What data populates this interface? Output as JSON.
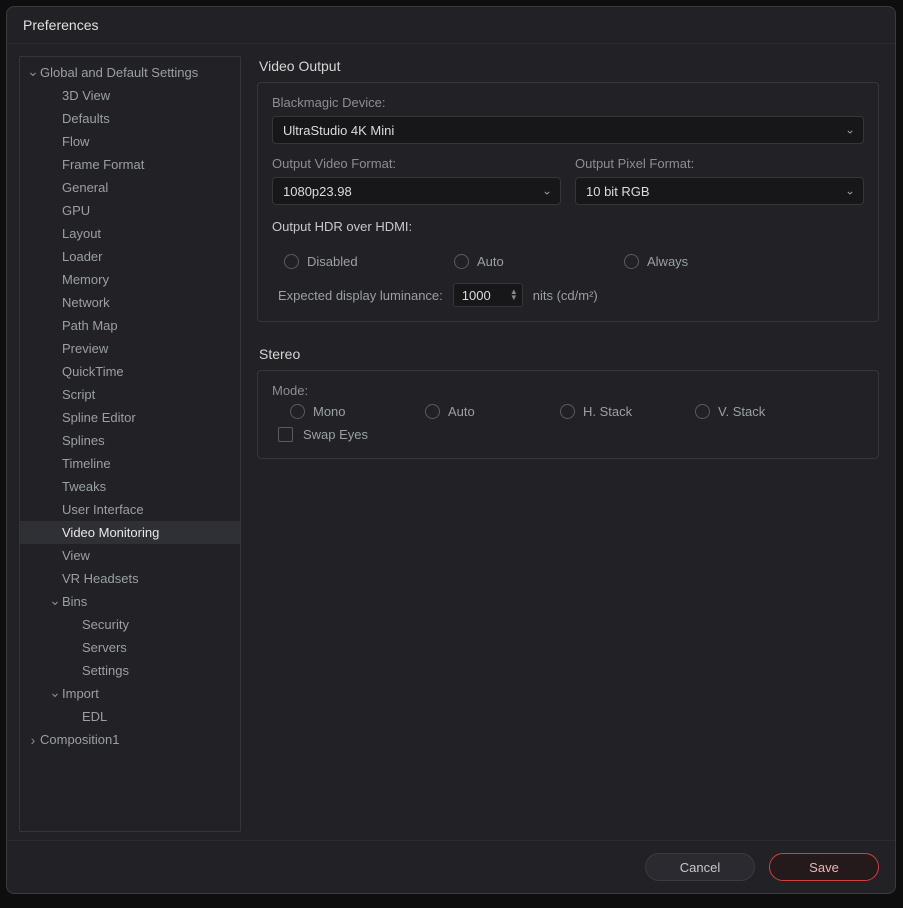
{
  "window": {
    "title": "Preferences"
  },
  "sidebar": {
    "group_global": "Global and Default Settings",
    "items_global": [
      "3D View",
      "Defaults",
      "Flow",
      "Frame Format",
      "General",
      "GPU",
      "Layout",
      "Loader",
      "Memory",
      "Network",
      "Path Map",
      "Preview",
      "QuickTime",
      "Script",
      "Spline Editor",
      "Splines",
      "Timeline",
      "Tweaks",
      "User Interface",
      "Video Monitoring",
      "View",
      "VR Headsets"
    ],
    "group_bins": "Bins",
    "items_bins": [
      "Security",
      "Servers",
      "Settings"
    ],
    "group_import": "Import",
    "items_import": [
      "EDL"
    ],
    "composition": "Composition1",
    "selected": "Video Monitoring"
  },
  "video_output": {
    "section": "Video Output",
    "device_label": "Blackmagic Device:",
    "device_value": "UltraStudio 4K Mini",
    "video_format_label": "Output Video Format:",
    "video_format_value": "1080p23.98",
    "pixel_format_label": "Output Pixel Format:",
    "pixel_format_value": "10 bit RGB",
    "hdr_label": "Output HDR over HDMI:",
    "hdr_options": {
      "disabled": "Disabled",
      "auto": "Auto",
      "always": "Always"
    },
    "luminance_label": "Expected display luminance:",
    "luminance_value": "1000",
    "luminance_units": "nits (cd/m²)"
  },
  "stereo": {
    "section": "Stereo",
    "mode_label": "Mode:",
    "options": {
      "mono": "Mono",
      "auto": "Auto",
      "hstack": "H. Stack",
      "vstack": "V. Stack"
    },
    "swap_eyes": "Swap Eyes"
  },
  "footer": {
    "cancel": "Cancel",
    "save": "Save"
  }
}
